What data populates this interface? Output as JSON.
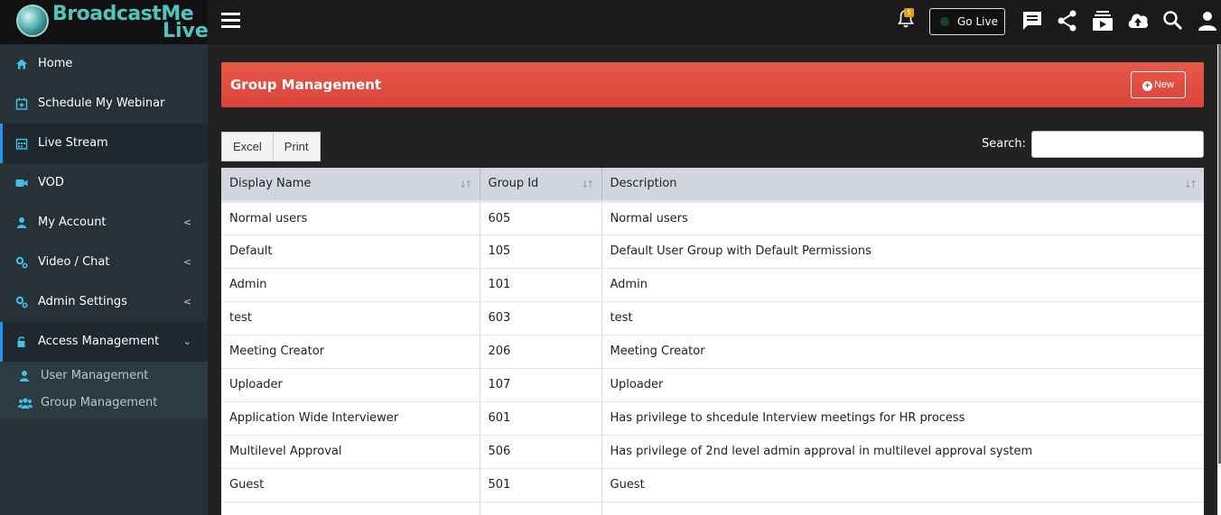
{
  "brand": {
    "line1": "BroadcastMe",
    "line2": "Live"
  },
  "topbar": {
    "notification_count": "5",
    "golive_label": "Go Live",
    "icons": [
      "bell-icon",
      "chat-icon",
      "share-icon",
      "playlist-icon",
      "upload-icon",
      "search-icon",
      "user-icon"
    ]
  },
  "sidebar": {
    "items": [
      {
        "label": "Home",
        "icon": "home-icon"
      },
      {
        "label": "Schedule My Webinar",
        "icon": "calendar-plus-icon"
      },
      {
        "label": "Live Stream",
        "icon": "calendar-icon"
      },
      {
        "label": "VOD",
        "icon": "video-camera-icon"
      },
      {
        "label": "My Account",
        "icon": "user-icon"
      },
      {
        "label": "Video / Chat",
        "icon": "gears-icon"
      },
      {
        "label": "Admin Settings",
        "icon": "gears-icon"
      },
      {
        "label": "Access Management",
        "icon": "lock-icon"
      }
    ],
    "subitems": [
      {
        "label": "User Management",
        "icon": "user-icon"
      },
      {
        "label": "Group Management",
        "icon": "users-icon"
      }
    ]
  },
  "page": {
    "title": "Group Management",
    "new_label": "New",
    "excel_label": "Excel",
    "print_label": "Print",
    "search_label": "Search:",
    "search_value": ""
  },
  "table": {
    "headers": [
      "Display Name",
      "Group Id",
      "Description"
    ],
    "rows": [
      [
        "Normal users",
        "605",
        "Normal users"
      ],
      [
        "Default",
        "105",
        "Default User Group with Default Permissions"
      ],
      [
        "Admin",
        "101",
        "Admin"
      ],
      [
        "test",
        "603",
        "test"
      ],
      [
        "Meeting Creator",
        "206",
        "Meeting Creator"
      ],
      [
        "Uploader",
        "107",
        "Uploader"
      ],
      [
        "Application Wide Interviewer",
        "601",
        "Has privilege to shcedule Interview meetings for HR process"
      ],
      [
        "Multilevel Approval",
        "506",
        "Has privilege of 2nd level admin approval in multilevel approval system"
      ],
      [
        "Guest",
        "501",
        "Guest"
      ],
      [
        "",
        "",
        ""
      ]
    ]
  },
  "colors": {
    "header_red": "#d9443a",
    "sidebar_bg": "#263238",
    "accent_blue": "#2196f3",
    "icon_cyan": "#3fc1e8"
  }
}
